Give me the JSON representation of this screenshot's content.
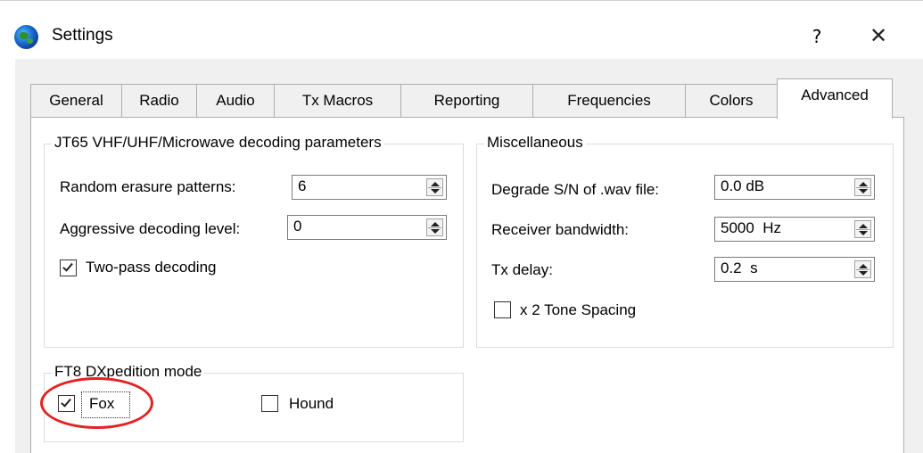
{
  "window": {
    "title": "Settings",
    "help_label": "?",
    "close_label": "✕"
  },
  "tabs": [
    {
      "label": "General",
      "active": false
    },
    {
      "label": "Radio",
      "active": false
    },
    {
      "label": "Audio",
      "active": false
    },
    {
      "label": "Tx Macros",
      "active": false
    },
    {
      "label": "Reporting",
      "active": false
    },
    {
      "label": "Frequencies",
      "active": false
    },
    {
      "label": "Colors",
      "active": false
    },
    {
      "label": "Advanced",
      "active": true
    }
  ],
  "jt65": {
    "title": "JT65 VHF/UHF/Microwave decoding parameters",
    "random_erasure_label": "Random erasure patterns:",
    "random_erasure_value": "6",
    "aggressive_label": "Aggressive decoding level:",
    "aggressive_value": "0",
    "two_pass_label": "Two-pass decoding",
    "two_pass_checked": true
  },
  "misc": {
    "title": "Miscellaneous",
    "degrade_label": "Degrade S/N of .wav file:",
    "degrade_value": "0.0 dB",
    "bandwidth_label": "Receiver bandwidth:",
    "bandwidth_value": "5000  Hz",
    "txdelay_label": "Tx delay:",
    "txdelay_value": "0.2  s",
    "tone_spacing_label": "x 2 Tone Spacing",
    "tone_spacing_checked": false
  },
  "ft8": {
    "title": "FT8 DXpedition mode",
    "fox_label": "Fox",
    "fox_checked": true,
    "hound_label": "Hound",
    "hound_checked": false
  },
  "annotation": {
    "ring_color": "#e32222"
  }
}
